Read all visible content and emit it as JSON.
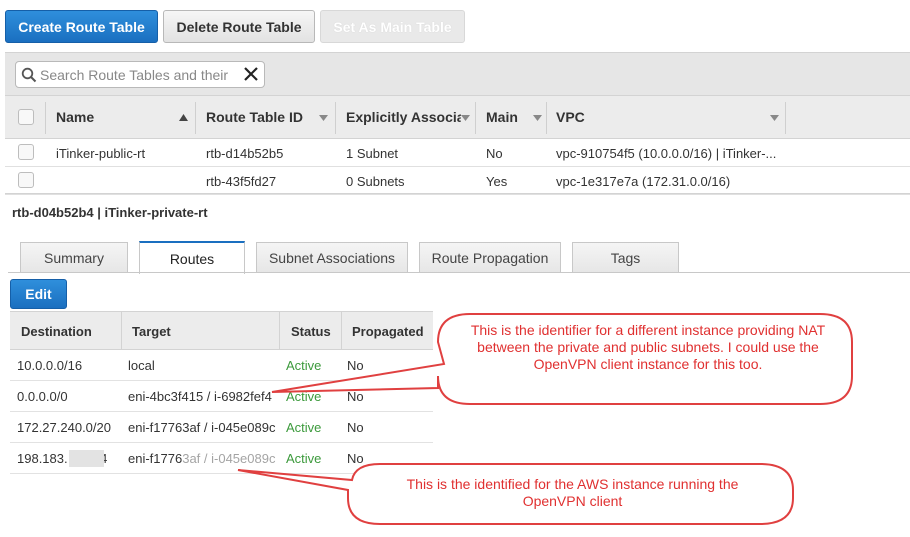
{
  "toolbar": {
    "create_label": "Create Route Table",
    "delete_label": "Delete Route Table",
    "set_main_label": "Set As Main Table"
  },
  "search": {
    "placeholder": "Search Route Tables and their"
  },
  "route_tables": {
    "columns": [
      "Name",
      "Route Table ID",
      "Explicitly Associat",
      "Main",
      "VPC"
    ],
    "rows": [
      {
        "name": "iTinker-public-rt",
        "id": "rtb-d14b52b5",
        "explicit": "1 Subnet",
        "main": "No",
        "vpc": "vpc-910754f5 (10.0.0.0/16) | iTinker-..."
      },
      {
        "name": "",
        "id": "rtb-43f5fd27",
        "explicit": "0 Subnets",
        "main": "Yes",
        "vpc": "vpc-1e317e7a (172.31.0.0/16)"
      }
    ]
  },
  "selected_title": "rtb-d04b52b4 | iTinker-private-rt",
  "tabs": [
    "Summary",
    "Routes",
    "Subnet Associations",
    "Route Propagation",
    "Tags"
  ],
  "active_tab": "Routes",
  "edit_label": "Edit",
  "routes": {
    "columns": [
      "Destination",
      "Target",
      "Status",
      "Propagated"
    ],
    "rows": [
      {
        "destination": "10.0.0.0/16",
        "target": "local",
        "status": "Active",
        "propagated": "No"
      },
      {
        "destination": "0.0.0.0/0",
        "target": "eni-4bc3f415 / i-6982fef4",
        "status": "Active",
        "propagated": "No"
      },
      {
        "destination": "172.27.240.0/20",
        "target": "eni-f17763af / i-045e089c",
        "status": "Active",
        "propagated": "No"
      },
      {
        "destination": "198.183.      /24",
        "target": "eni-f17763af / i-045e089c",
        "status": "Active",
        "propagated": "No"
      }
    ]
  },
  "callouts": {
    "nat": "This is the identifier for a different instance providing NAT between the private and public subnets.  I could use the OpenVPN client instance for this too.",
    "vpn": "This is the identified for the AWS instance running the OpenVPN client"
  },
  "colors": {
    "primary": "#1a6fc0",
    "active_status": "#3c9a3c",
    "callout_stroke": "#e04040",
    "callout_text": "#e03030"
  }
}
